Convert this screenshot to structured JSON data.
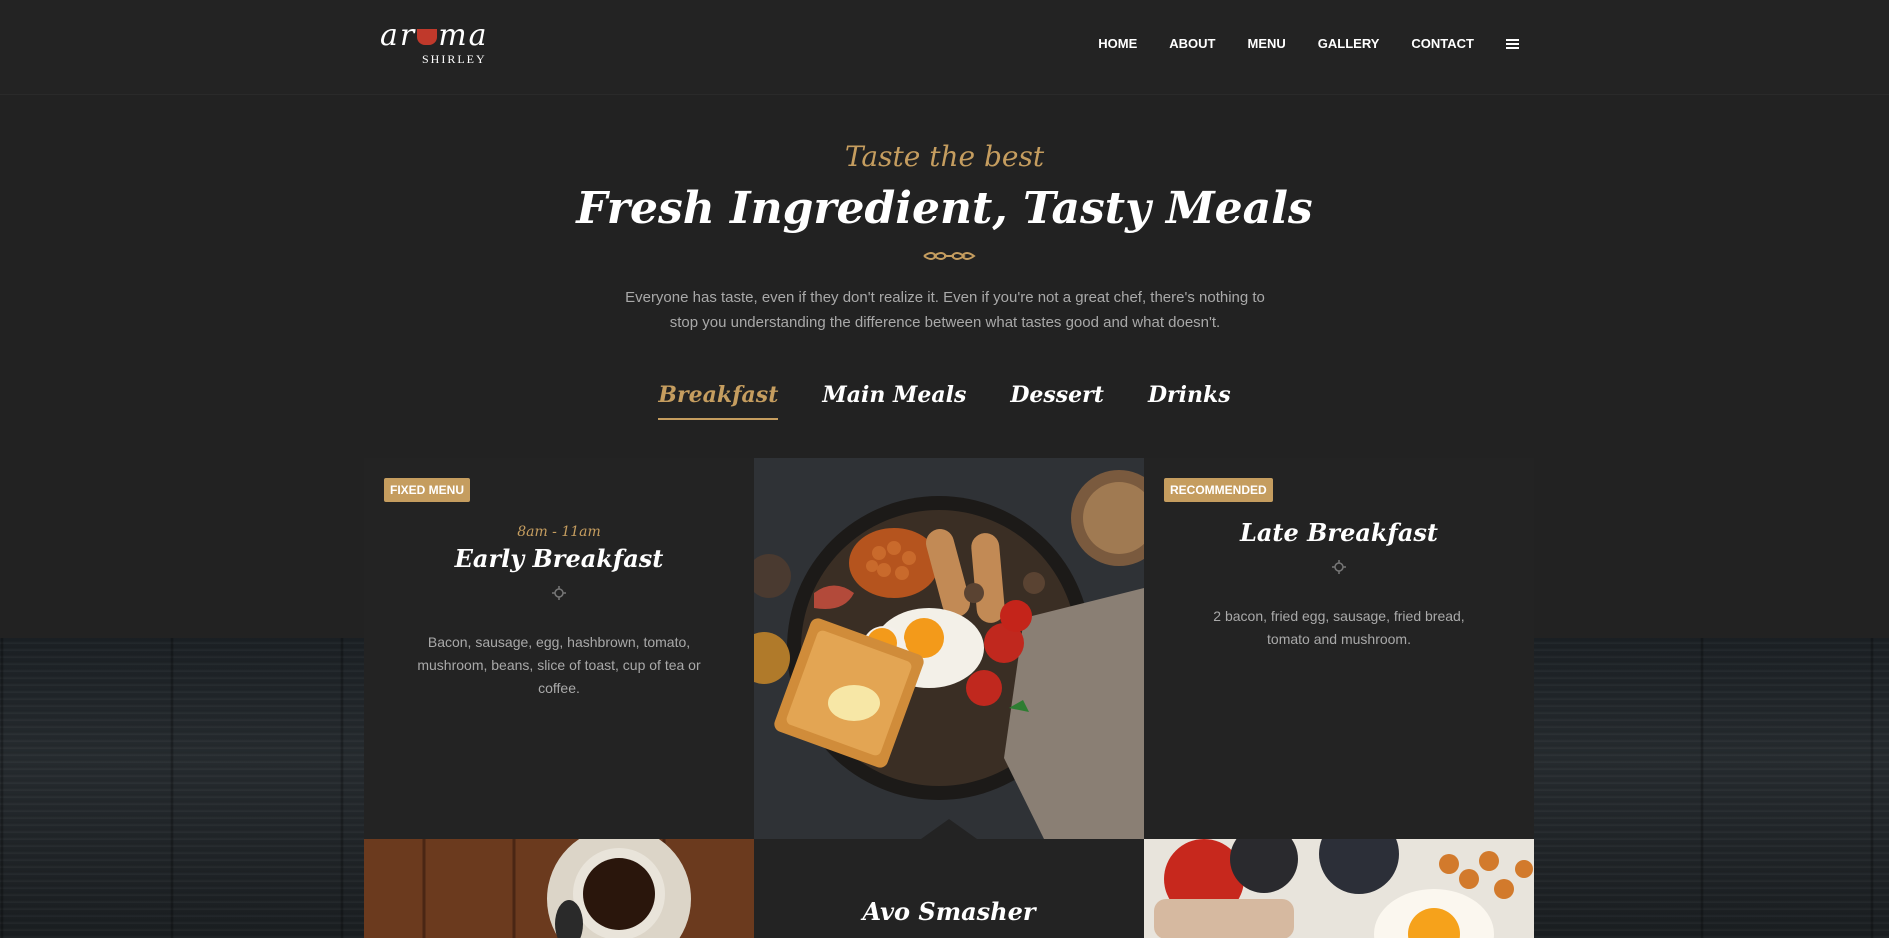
{
  "header": {
    "logo": {
      "main_text": "ar ma",
      "sub_text": "SHIRLEY"
    },
    "nav": [
      "HOME",
      "ABOUT",
      "MENU",
      "GALLERY",
      "CONTACT"
    ],
    "menu_icon": "hamburger-icon"
  },
  "hero": {
    "kicker": "Taste the best",
    "title": "Fresh Ingredient, Tasty Meals",
    "intro": "Everyone has taste, even if they don't realize it. Even if you're not a great chef, there's nothing to stop you understanding the difference between what tastes good and what doesn't."
  },
  "tabs": [
    {
      "label": "Breakfast",
      "active": true
    },
    {
      "label": "Main Meals",
      "active": false
    },
    {
      "label": "Dessert",
      "active": false
    },
    {
      "label": "Drinks",
      "active": false
    }
  ],
  "cards": {
    "early": {
      "badge": "FIXED MENU",
      "time": "8am - 11am",
      "title": "Early Breakfast",
      "desc": "Bacon, sausage, egg, hashbrown, tomato, mushroom, beans, slice of toast, cup of tea or coffee."
    },
    "late": {
      "badge": "RECOMMENDED",
      "title": "Late Breakfast",
      "desc": "2 bacon, fried egg, sausage, fried bread, tomato and mushroom."
    },
    "avo": {
      "title": "Avo Smasher"
    }
  },
  "colors": {
    "accent": "#c59d5f",
    "background": "#222222",
    "card": "#232323",
    "text_muted": "#a9a9a9"
  }
}
